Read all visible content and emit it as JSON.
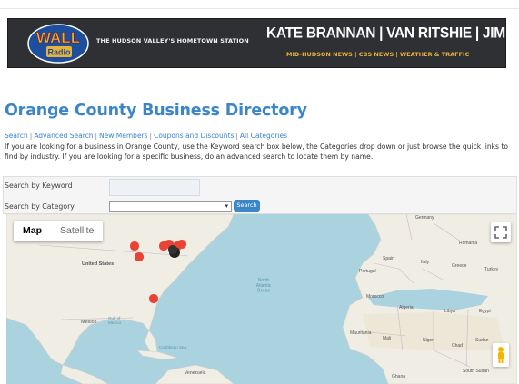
{
  "banner": {
    "logo_text_top": "WALL",
    "logo_text_bottom": "Radio",
    "tagline": "THE HUDSON VALLEY'S HOMETOWN STATION",
    "hosts": "KATE BRANNAN | VAN RITSHIE | JIM FREY",
    "subline": "MID-HUDSON NEWS | CBS NEWS | WEATHER & TRAFFIC"
  },
  "page": {
    "title": "Orange County Business Directory",
    "intro": "If you are looking for a business in Orange County, use the Keyword search box below, the Categories drop down or just browse the quick links to find by industry. If you are looking for a specific business, do an advanced search to locate them by name."
  },
  "quick_links": [
    "Search",
    "Advanced Search",
    "New Members",
    "Coupons and Discounts",
    "All Categories"
  ],
  "search": {
    "keyword_label": "Search by Keyword",
    "keyword_value": "",
    "category_label": "Search by Category",
    "category_value": "",
    "button_label": "Search"
  },
  "map": {
    "tab_map": "Map",
    "tab_satellite": "Satellite",
    "active_tab": "Map",
    "labels": {
      "united_states": "United States",
      "mexico": "Mexico",
      "gulf_of_mexico": "Gulf of\nMexico",
      "caribbean_sea": "Caribbean Sea",
      "venezuela": "Venezuela",
      "north_atlantic_ocean": "North\nAtlantic\nOcean",
      "germany": "Germany",
      "romania": "Romania",
      "spain": "Spain",
      "portugal": "Portugal",
      "italy": "Italy",
      "greece": "Greece",
      "turkey": "Turkey",
      "morocco": "Morocco",
      "algeria": "Algeria",
      "libya": "Libya",
      "egypt": "Egypt",
      "mauritania": "Mauritania",
      "mali": "Mali",
      "niger": "Niger",
      "chad": "Chad",
      "sudan": "Sudan",
      "south_sudan": "South Sudan",
      "ghana": "Ghana"
    },
    "colors": {
      "water": "#aad3df",
      "land": "#f0ede5",
      "marker": "#ea4335",
      "marker_dark": "#222222"
    }
  }
}
